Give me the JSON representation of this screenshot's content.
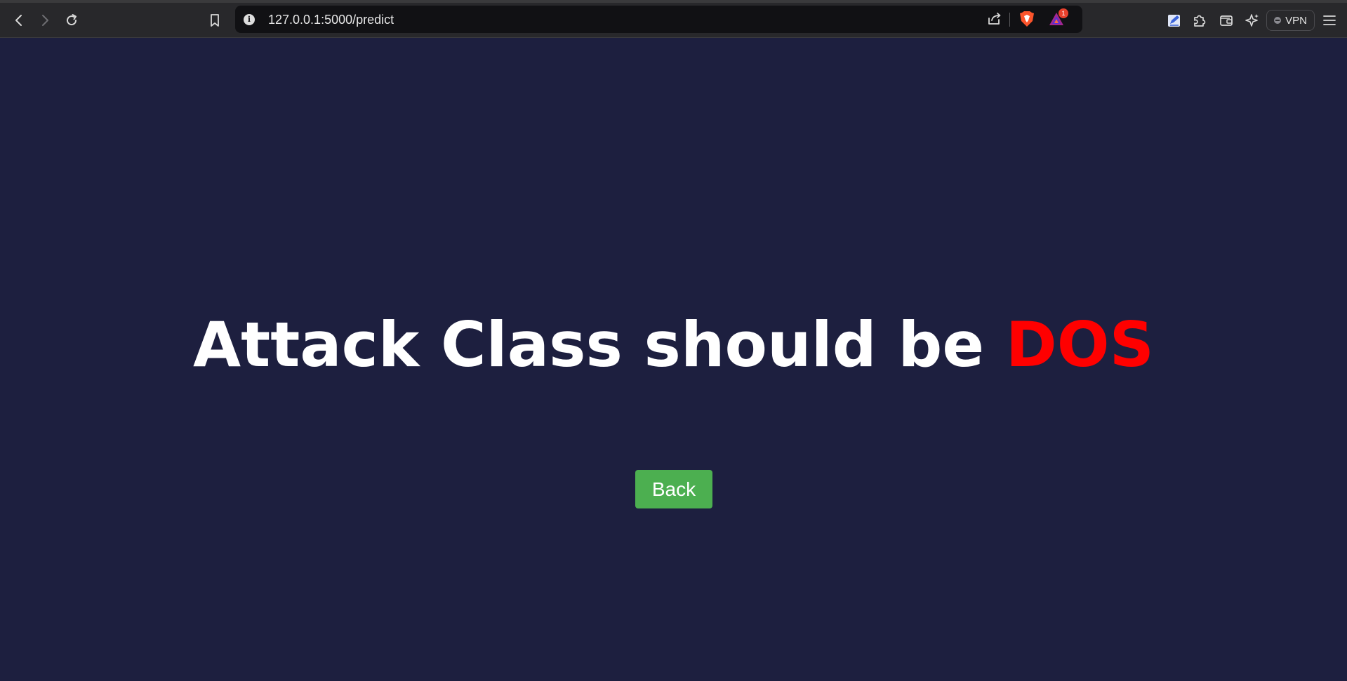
{
  "browser": {
    "url": "127.0.0.1:5000/predict",
    "rewards_badge": "1",
    "vpn_label": "VPN",
    "icons": [
      "back-icon",
      "forward-icon",
      "reload-icon",
      "bookmark-icon",
      "site-info-icon",
      "share-icon",
      "brave-shields-icon",
      "brave-rewards-icon",
      "edit-icon",
      "extensions-icon",
      "wallet-icon",
      "leo-ai-icon",
      "vpn-icon",
      "menu-icon"
    ]
  },
  "page": {
    "heading_prefix": "Attack Class should be ",
    "prediction": "DOS",
    "back_label": "Back"
  },
  "colors": {
    "background": "#1d1f3f",
    "heading": "#ffffff",
    "prediction": "#ff0000",
    "button": "#4caf50"
  }
}
